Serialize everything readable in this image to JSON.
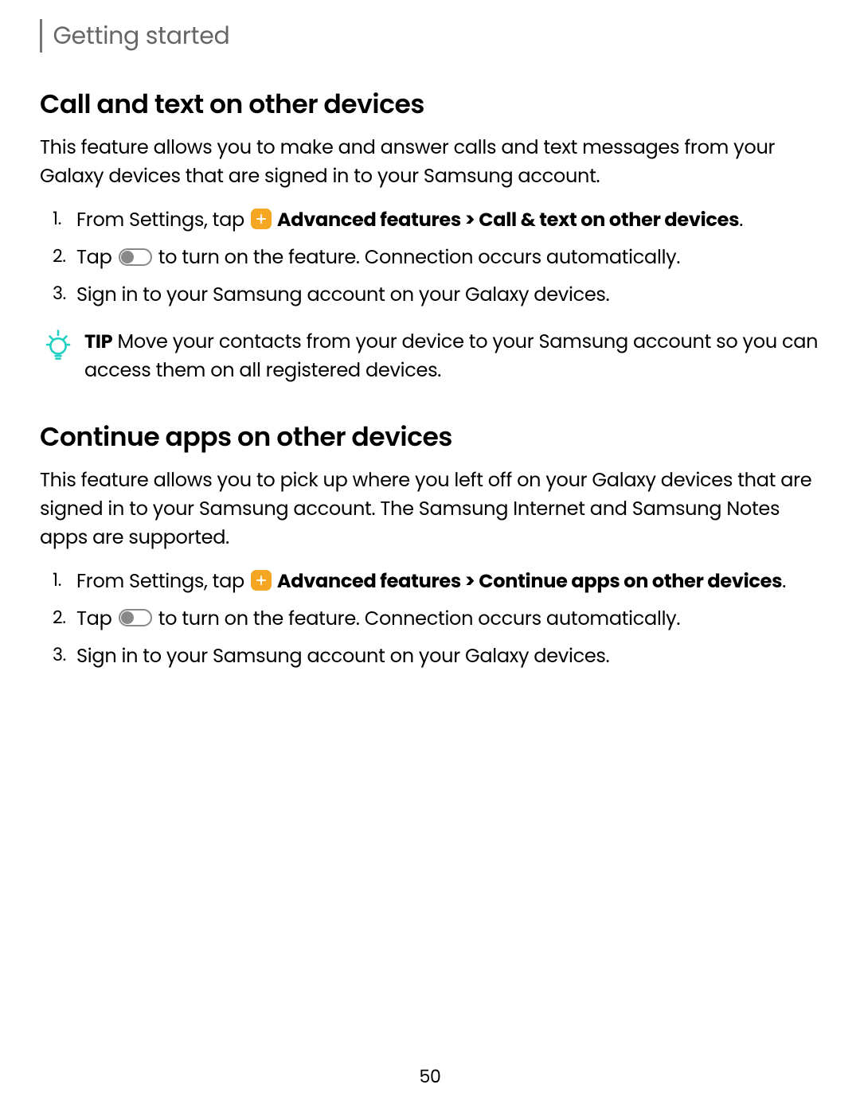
{
  "sectionLabel": "Getting started",
  "pageNumber": "50",
  "section1": {
    "heading": "Call and text on other devices",
    "intro": "This feature allows you to make and answer calls and text messages from your Galaxy devices that are signed in to your Samsung account.",
    "step1_prefix": "From Settings, tap ",
    "step1_boldPath": " Advanced features > Call & text on other devices",
    "step1_suffix": ".",
    "step2_prefix": "Tap ",
    "step2_suffix": " to turn on the feature. Connection occurs automatically.",
    "step3": "Sign in to your Samsung account on your Galaxy devices."
  },
  "tip": {
    "label": "TIP",
    "text": "  Move your contacts from your device to your Samsung account so you can access them on all registered devices."
  },
  "section2": {
    "heading": "Continue apps on other devices",
    "intro": "This feature allows you to pick up where you left off on your Galaxy devices that are signed in to your Samsung account. The Samsung Internet and Samsung Notes apps are supported.",
    "step1_prefix": "From Settings, tap ",
    "step1_boldPath": " Advanced features > Continue apps on other devices",
    "step1_suffix": ".",
    "step2_prefix": "Tap ",
    "step2_suffix": " to turn on the feature. Connection occurs automatically.",
    "step3": "Sign in to your Samsung account on your Galaxy devices."
  }
}
